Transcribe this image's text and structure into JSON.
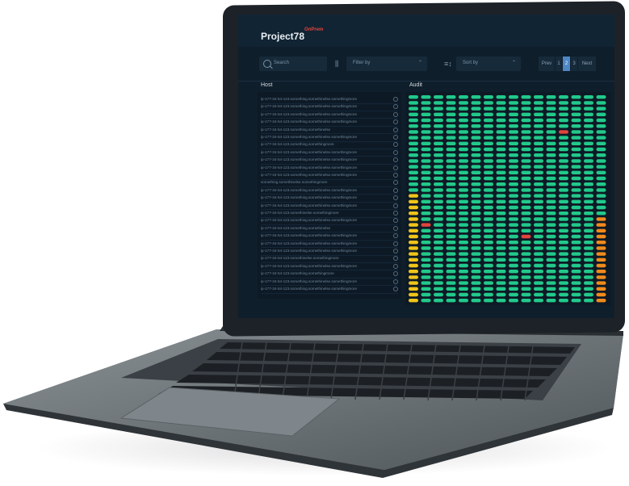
{
  "app": {
    "brand_name": "Project78",
    "brand_suffix": "OnPrem"
  },
  "toolbar": {
    "search_placeholder": "Search",
    "filter_label": "Filter by",
    "sort_label": "Sort by"
  },
  "pagination": {
    "prev": "Prev",
    "pages": [
      "1",
      "2",
      "3"
    ],
    "active_page": "2",
    "next": "Next"
  },
  "host_column": {
    "title": "Host",
    "rows": [
      "ip-177-34-54-123.something.somethinelse.somethingmore",
      "ip-177-34-54-123.something.somethinelse.somethingmore",
      "ip-177-34-54-123.something.somethinelse.somethingmore",
      "ip-177-34-54-123.something.somethinelse.somethingmore",
      "ip-177-34-54-123.something.somethinelse",
      "ip-177-34-54-123.something.somethinelse.somethingmore",
      "ip-177-34-54-123.something.somethingmore",
      "ip-177-34-54-123.something.somethinelse.somethingmore",
      "ip-177-34-54-123.something.somethinelse.somethingmore",
      "ip-177-34-54-123.something.somethinelse.somethingmore",
      "ip-177-34-54-123.something.somethinelse.somethingmore",
      "something.somethinelse.somethingmore",
      "ip-177-34-54-123.something.somethinelse.somethingmore",
      "ip-177-34-54-123.something.somethinelse.somethingmore",
      "ip-177-34-54-123.something.somethinelse.somethingmore",
      "ip-177-34-54-123.somethinelse.somethingmore",
      "ip-177-34-54-123.something.somethinelse.somethingmore",
      "ip-177-34-54-123.something.somethinelse",
      "ip-177-34-54-123.something.somethinelse.somethingmore",
      "ip-177-34-54-123.something.somethinelse.somethingmore",
      "ip-177-34-54-123.something.somethinelse.somethingmore",
      "ip-177-34-54-123.somethinelse.somethingmore",
      "ip-177-34-54-123.something.somethinelse.somethingmore",
      "ip-177-34-54-123.something.somethingmore",
      "ip-177-34-54-123.something.somethinelse.somethingmore",
      "ip-177-34-54-123.something.somethinelse.somethingmore"
    ]
  },
  "audit_column": {
    "title": "Audit",
    "colors": {
      "ok": "#22c98a",
      "warn": "#f0c419",
      "alert": "#f08a1c",
      "fail": "#e0443c"
    }
  }
}
